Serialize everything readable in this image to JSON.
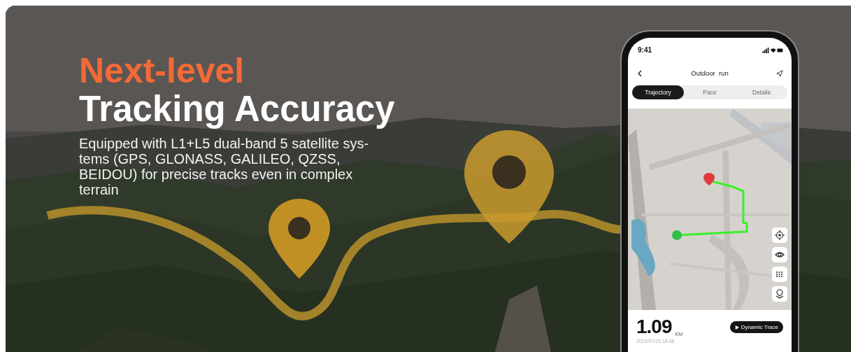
{
  "banner": {
    "headline_accent": "Next-level",
    "headline": "Tracking Accuracy",
    "description": "Equipped with L1+L5 dual-band 5 satellite sys-tems (GPS, GLONASS, GALILEO, QZSS, BEIDOU) for precise tracks even in complex terrain"
  },
  "phone": {
    "status_time": "9:41",
    "title": "Outdoor  run",
    "tabs": [
      {
        "label": "Trajectory",
        "selected": true
      },
      {
        "label": "Pace",
        "selected": false
      },
      {
        "label": "Details",
        "selected": false
      }
    ],
    "summary": {
      "distance": "1.09",
      "unit": "KM",
      "date": "2023/07/29 18:46",
      "action": "Dynamic Trace"
    }
  }
}
